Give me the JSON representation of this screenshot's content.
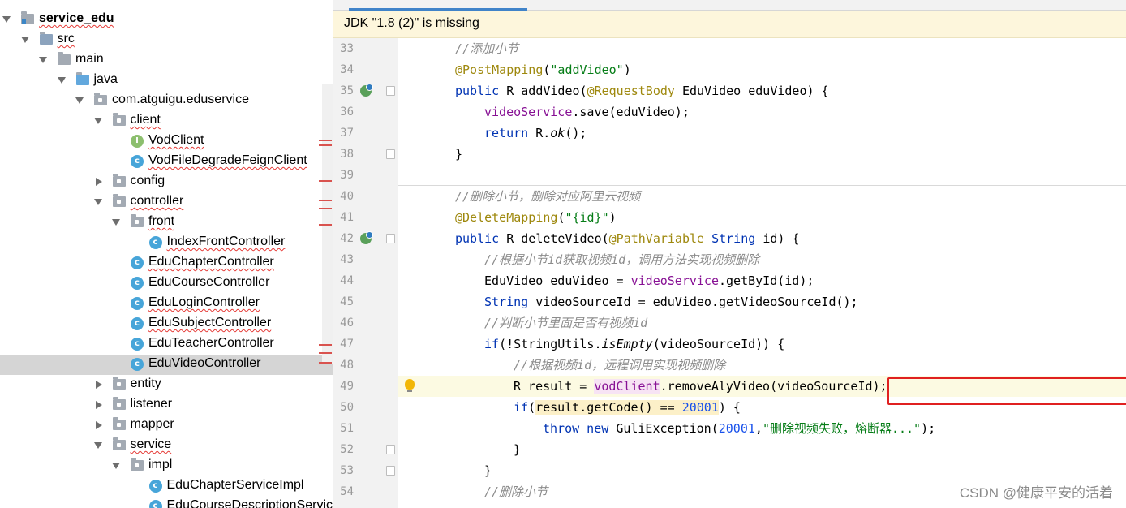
{
  "tree": {
    "items": [
      {
        "label": "service_edu",
        "depth": 0,
        "icon": "module-folder",
        "expanded": true,
        "bold": true,
        "squiggle": true
      },
      {
        "label": "src",
        "depth": 1,
        "icon": "source-folder",
        "expanded": true,
        "squiggle": true
      },
      {
        "label": "main",
        "depth": 2,
        "icon": "folder",
        "expanded": true
      },
      {
        "label": "java",
        "depth": 3,
        "icon": "java-folder",
        "expanded": true
      },
      {
        "label": "com.atguigu.eduservice",
        "depth": 4,
        "icon": "package",
        "expanded": true
      },
      {
        "label": "client",
        "depth": 5,
        "icon": "package",
        "expanded": true,
        "squiggle": true
      },
      {
        "label": "VodClient",
        "depth": 6,
        "icon": "interface",
        "squiggle": true
      },
      {
        "label": "VodFileDegradeFeignClient",
        "depth": 6,
        "icon": "class",
        "squiggle": true
      },
      {
        "label": "config",
        "depth": 5,
        "icon": "package",
        "expanded": false
      },
      {
        "label": "controller",
        "depth": 5,
        "icon": "package",
        "expanded": true,
        "squiggle": true
      },
      {
        "label": "front",
        "depth": 6,
        "icon": "package",
        "expanded": true,
        "squiggle": true
      },
      {
        "label": "IndexFrontController",
        "depth": 7,
        "icon": "class",
        "squiggle": true
      },
      {
        "label": "EduChapterController",
        "depth": 6,
        "icon": "class",
        "squiggle": true
      },
      {
        "label": "EduCourseController",
        "depth": 6,
        "icon": "class"
      },
      {
        "label": "EduLoginController",
        "depth": 6,
        "icon": "class",
        "squiggle": true
      },
      {
        "label": "EduSubjectController",
        "depth": 6,
        "icon": "class",
        "squiggle": true
      },
      {
        "label": "EduTeacherController",
        "depth": 6,
        "icon": "class"
      },
      {
        "label": "EduVideoController",
        "depth": 6,
        "icon": "class",
        "selected": true
      },
      {
        "label": "entity",
        "depth": 5,
        "icon": "package",
        "expanded": false
      },
      {
        "label": "listener",
        "depth": 5,
        "icon": "package",
        "expanded": false
      },
      {
        "label": "mapper",
        "depth": 5,
        "icon": "package",
        "expanded": false
      },
      {
        "label": "service",
        "depth": 5,
        "icon": "package",
        "expanded": true,
        "squiggle": true
      },
      {
        "label": "impl",
        "depth": 6,
        "icon": "package",
        "expanded": true
      },
      {
        "label": "EduChapterServiceImpl",
        "depth": 7,
        "icon": "class"
      },
      {
        "label": "EduCourseDescriptionServic",
        "depth": 7,
        "icon": "class"
      }
    ]
  },
  "banner": {
    "text": "JDK \"1.8 (2)\" is missing"
  },
  "editor": {
    "lines": [
      {
        "n": "33",
        "indent": 1,
        "tokens": [
          [
            "cm",
            "//添加小节"
          ]
        ]
      },
      {
        "n": "34",
        "indent": 1,
        "tokens": [
          [
            "an",
            "@PostMapping"
          ],
          [
            "",
            "("
          ],
          [
            "st",
            "\"addVideo\""
          ],
          [
            "",
            ")"
          ]
        ]
      },
      {
        "n": "35",
        "indent": 1,
        "run": true,
        "fold": true,
        "tokens": [
          [
            "kw",
            "public "
          ],
          [
            "",
            "R "
          ],
          [
            "",
            "addVideo("
          ],
          [
            "an",
            "@RequestBody "
          ],
          [
            "",
            "EduVideo eduVideo) {"
          ]
        ]
      },
      {
        "n": "36",
        "indent": 2,
        "tokens": [
          [
            "fld",
            "videoService"
          ],
          [
            "",
            ".save(eduVideo);"
          ]
        ]
      },
      {
        "n": "37",
        "indent": 2,
        "tokens": [
          [
            "kw",
            "return "
          ],
          [
            "",
            "R."
          ],
          [
            "it",
            "ok"
          ],
          [
            "",
            "();"
          ]
        ]
      },
      {
        "n": "38",
        "indent": 1,
        "fold": true,
        "tokens": [
          [
            "",
            "}"
          ]
        ]
      },
      {
        "n": "39",
        "indent": 0,
        "tokens": []
      },
      {
        "n": "40",
        "indent": 1,
        "separator": true,
        "tokens": [
          [
            "cm",
            "//删除小节，删除对应阿里云视频"
          ]
        ]
      },
      {
        "n": "41",
        "indent": 1,
        "tokens": [
          [
            "an",
            "@DeleteMapping"
          ],
          [
            "",
            "("
          ],
          [
            "st",
            "\"{id}\""
          ],
          [
            "",
            ")"
          ]
        ]
      },
      {
        "n": "42",
        "indent": 1,
        "run": true,
        "fold": true,
        "tokens": [
          [
            "kw",
            "public "
          ],
          [
            "",
            "R "
          ],
          [
            "",
            "deleteVideo("
          ],
          [
            "an",
            "@PathVariable "
          ],
          [
            "kw",
            "String "
          ],
          [
            "",
            "id) {"
          ]
        ]
      },
      {
        "n": "43",
        "indent": 2,
        "tokens": [
          [
            "cm",
            "//根据小节id获取视频id，调用方法实现视频删除"
          ]
        ]
      },
      {
        "n": "44",
        "indent": 2,
        "tokens": [
          [
            "",
            "EduVideo eduVideo = "
          ],
          [
            "fld",
            "videoService"
          ],
          [
            "",
            ".getById(id);"
          ]
        ]
      },
      {
        "n": "45",
        "indent": 2,
        "tokens": [
          [
            "kw",
            "String "
          ],
          [
            "",
            "videoSourceId = eduVideo.getVideoSourceId();"
          ]
        ]
      },
      {
        "n": "46",
        "indent": 2,
        "tokens": [
          [
            "cm",
            "//判断小节里面是否有视频id"
          ]
        ]
      },
      {
        "n": "47",
        "indent": 2,
        "tokens": [
          [
            "kw",
            "if"
          ],
          [
            "",
            "(!StringUtils."
          ],
          [
            "it",
            "isEmpty"
          ],
          [
            "",
            "(videoSourceId)) {"
          ]
        ]
      },
      {
        "n": "48",
        "indent": 3,
        "tokens": [
          [
            "cm",
            "//根据视频id，远程调用实现视频删除"
          ]
        ]
      },
      {
        "n": "49",
        "indent": 3,
        "highlight": true,
        "bulb": true,
        "tokens": [
          [
            "",
            "R result = "
          ],
          [
            "fldbg",
            "vodClient"
          ],
          [
            "",
            ".removeAlyVideo(videoSourceId);"
          ]
        ]
      },
      {
        "n": "50",
        "indent": 3,
        "tokens": [
          [
            "kw",
            "if"
          ],
          [
            "",
            "("
          ],
          [
            "ybg",
            "result.getCode() == "
          ],
          [
            "numbg",
            "20001"
          ],
          [
            "",
            ") {"
          ]
        ]
      },
      {
        "n": "51",
        "indent": 4,
        "tokens": [
          [
            "kw",
            "throw new "
          ],
          [
            "",
            "GuliException("
          ],
          [
            "num",
            "20001"
          ],
          [
            "",
            ","
          ],
          [
            "st",
            "\"删除视频失败，熔断器...\""
          ],
          [
            "",
            ");"
          ]
        ]
      },
      {
        "n": "52",
        "indent": 3,
        "fold": true,
        "tokens": [
          [
            "",
            "}"
          ]
        ]
      },
      {
        "n": "53",
        "indent": 2,
        "fold": true,
        "tokens": [
          [
            "",
            "}"
          ]
        ]
      },
      {
        "n": "54",
        "indent": 2,
        "tokens": [
          [
            "cm",
            "//删除小节"
          ]
        ]
      }
    ]
  },
  "watermark": "CSDN @健康平安的活着",
  "colors": {
    "keyword": "#0033b3",
    "annotation": "#9e880d",
    "string": "#067d17",
    "comment": "#8c8c8c",
    "field": "#871094",
    "number": "#1750eb",
    "selection": "#d5d5d5",
    "redbox": "#e02020"
  }
}
